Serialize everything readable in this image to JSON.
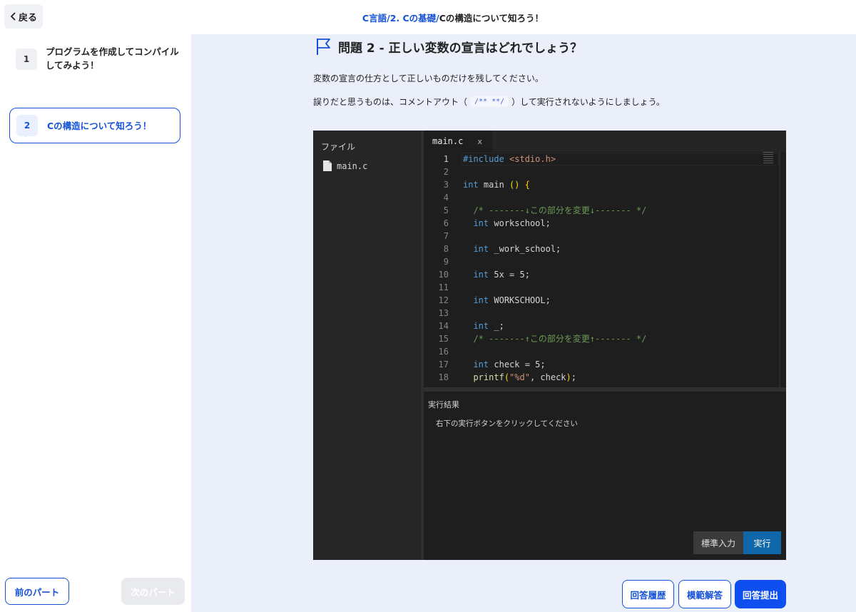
{
  "header": {
    "back_label": "戻る",
    "breadcrumb": {
      "course": "C言語",
      "sep1": "/",
      "chapter": "2. Cの基礎",
      "sep2": "/",
      "current": "Cの構造について知ろう！"
    }
  },
  "sidebar": {
    "steps": [
      {
        "number": "1",
        "label": "プログラムを作成してコンパイルしてみよう！"
      },
      {
        "number": "2",
        "label": "Cの構造について知ろう！"
      }
    ],
    "prev_label": "前のパート",
    "next_label": "次のパート"
  },
  "question": {
    "title": "問題 2 - 正しい変数の宣言はどれでしょう？",
    "instruction1": "変数の宣言の仕方として正しいものだけを残してください。",
    "instruction2_before": "誤りだと思うものは、コメントアウト（",
    "comment_syntax": "/** **/",
    "instruction2_after": "）して実行されないようにしましょう。"
  },
  "editor": {
    "file_panel_title": "ファイル",
    "files": [
      "main.c"
    ],
    "active_tab": "main.c",
    "tab_close": "x",
    "code_lines": [
      {
        "n": "1",
        "indent": "",
        "segments": [
          {
            "t": "#include ",
            "c": "kw"
          },
          {
            "t": "<stdio.h>",
            "c": "str"
          }
        ]
      },
      {
        "n": "2",
        "indent": "",
        "segments": []
      },
      {
        "n": "3",
        "indent": "",
        "segments": [
          {
            "t": "int",
            "c": "kw"
          },
          {
            "t": " main ",
            "c": ""
          },
          {
            "t": "()",
            "c": "br"
          },
          {
            "t": " ",
            "c": ""
          },
          {
            "t": "{",
            "c": "br"
          }
        ]
      },
      {
        "n": "4",
        "indent": "",
        "segments": []
      },
      {
        "n": "5",
        "indent": "  ",
        "segments": [
          {
            "t": "/* -------↓この部分を変更↓------- */",
            "c": "cm"
          }
        ]
      },
      {
        "n": "6",
        "indent": "  ",
        "segments": [
          {
            "t": "int",
            "c": "kw"
          },
          {
            "t": " workschool;",
            "c": ""
          }
        ]
      },
      {
        "n": "7",
        "indent": "",
        "segments": []
      },
      {
        "n": "8",
        "indent": "  ",
        "segments": [
          {
            "t": "int",
            "c": "kw"
          },
          {
            "t": " _work_school;",
            "c": ""
          }
        ]
      },
      {
        "n": "9",
        "indent": "",
        "segments": []
      },
      {
        "n": "10",
        "indent": "  ",
        "segments": [
          {
            "t": "int",
            "c": "kw"
          },
          {
            "t": " 5x = 5;",
            "c": ""
          }
        ]
      },
      {
        "n": "11",
        "indent": "",
        "segments": []
      },
      {
        "n": "12",
        "indent": "  ",
        "segments": [
          {
            "t": "int",
            "c": "kw"
          },
          {
            "t": " WORKSCHOOL;",
            "c": ""
          }
        ]
      },
      {
        "n": "13",
        "indent": "",
        "segments": []
      },
      {
        "n": "14",
        "indent": "  ",
        "segments": [
          {
            "t": "int",
            "c": "kw"
          },
          {
            "t": " _;",
            "c": ""
          }
        ]
      },
      {
        "n": "15",
        "indent": "  ",
        "segments": [
          {
            "t": "/* -------↑この部分を変更↑------- */",
            "c": "cm"
          }
        ]
      },
      {
        "n": "16",
        "indent": "",
        "segments": []
      },
      {
        "n": "17",
        "indent": "  ",
        "segments": [
          {
            "t": "int",
            "c": "kw"
          },
          {
            "t": " check = 5;",
            "c": ""
          }
        ]
      },
      {
        "n": "18",
        "indent": "  ",
        "segments": [
          {
            "t": "printf",
            "c": "fn"
          },
          {
            "t": "(",
            "c": "br"
          },
          {
            "t": "\"%d\"",
            "c": "str"
          },
          {
            "t": ", check",
            "c": ""
          },
          {
            "t": ")",
            "c": "br"
          },
          {
            "t": ";",
            "c": ""
          }
        ]
      }
    ],
    "result_title": "実行結果",
    "result_text": "右下の実行ボタンをクリックしてください",
    "stdin_label": "標準入力",
    "run_label": "実行"
  },
  "actions": {
    "history_label": "回答履歴",
    "model_answer_label": "模範解答",
    "submit_label": "回答提出"
  },
  "colors": {
    "accent": "#1452d9",
    "submit": "#0f4ff0",
    "run": "#0f66a8",
    "editor_bg": "#1e1e1e"
  }
}
